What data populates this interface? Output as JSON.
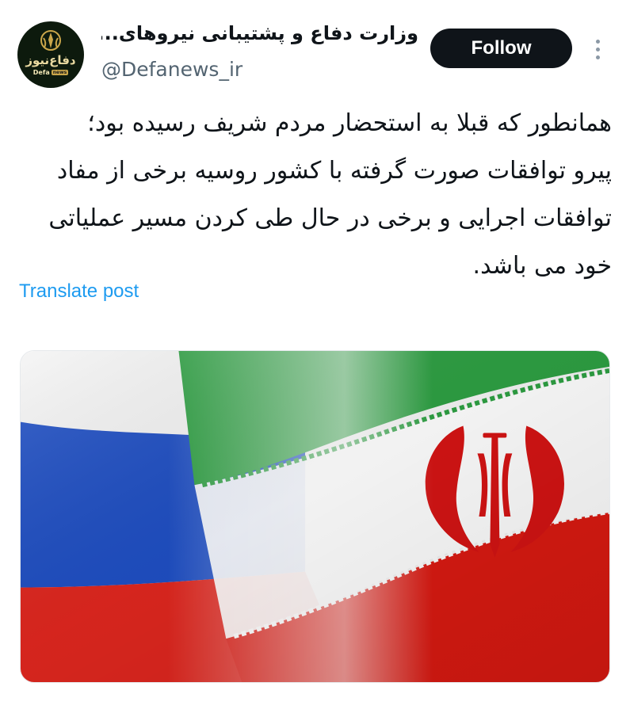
{
  "author": {
    "display_name": "وزارت دفاع و پشتیبانی نیروهای...",
    "handle": "@Defanews_ir",
    "avatar": {
      "logo_text": "دفاع‌نیوز",
      "logo_sub_left": "Defa",
      "logo_sub_right": "news"
    }
  },
  "follow_button": {
    "label": "Follow"
  },
  "more_icon": "vertical-dots-icon",
  "post": {
    "lines": [
      "همانطور که قبلا به استحضار مردم شریف رسیده بود؛",
      "پیرو توافقات صورت گرفته با کشور روسیه برخی از مفاد",
      "توافقات اجرایی و برخی در حال طی کردن مسیر عملیاتی",
      "خود می باشد."
    ],
    "translate_label": "Translate post"
  },
  "colors": {
    "follow_bg": "#0f1419",
    "link": "#1d9bf0",
    "handle": "#536471",
    "iran_green": "#239f40",
    "iran_red": "#da0000",
    "russia_blue": "#0039a6",
    "russia_red": "#d52b1e"
  }
}
